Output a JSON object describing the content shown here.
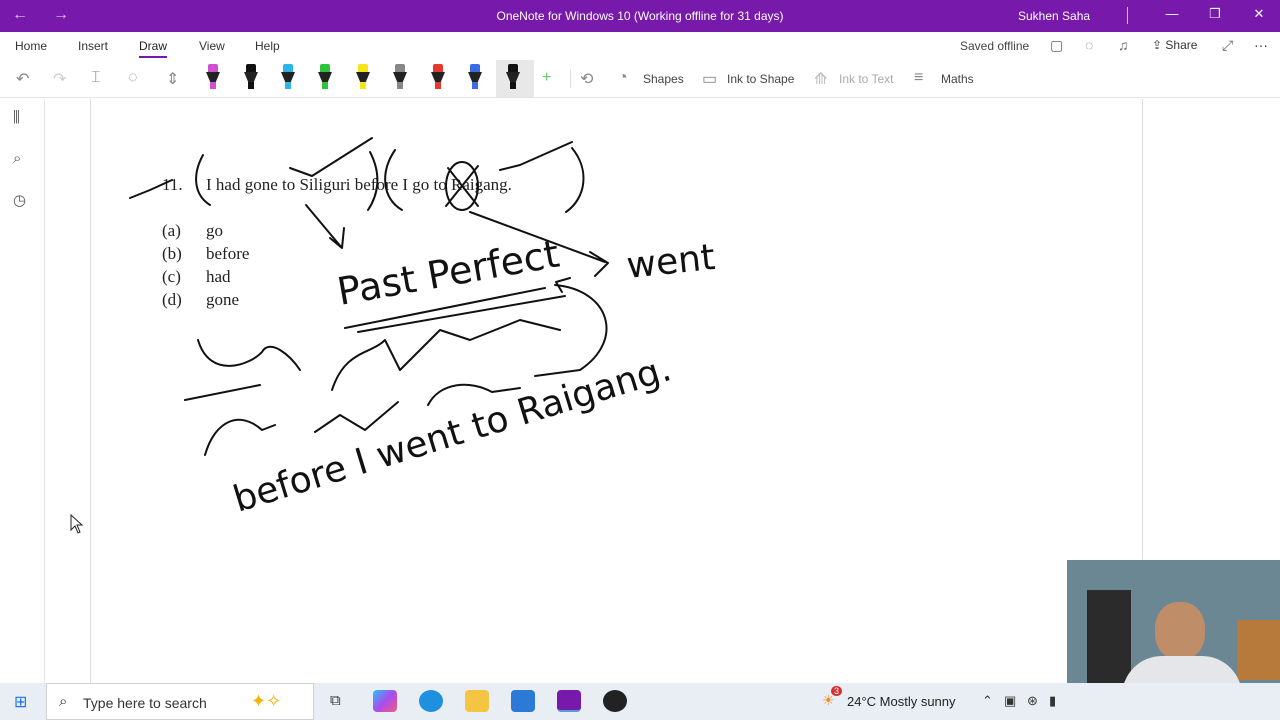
{
  "window": {
    "title": "OneNote for Windows 10 (Working offline for 31 days)",
    "user": "Sukhen Saha",
    "back_icon": "arrow-left-icon",
    "forward_icon": "arrow-right-icon"
  },
  "ribbon": {
    "tabs": [
      "Home",
      "Insert",
      "Draw",
      "View",
      "Help"
    ],
    "active_tab": "Draw",
    "status": "Saved offline",
    "share_label": "Share",
    "more_label": "···"
  },
  "toolbar": {
    "shapes_label": "Shapes",
    "ink_to_shape_label": "Ink to Shape",
    "ink_to_text_label": "Ink to Text",
    "maths_label": "Maths",
    "pen_colors": [
      "#d14fd1",
      "#111111",
      "#2bb6e8",
      "#2ec43a",
      "#f5e416",
      "#888888",
      "#e23b2e",
      "#3a6de2",
      "#111111"
    ]
  },
  "note": {
    "question_number": "11.",
    "sentence": "I had gone to Siliguri before I go to Raigang.",
    "options": [
      {
        "label": "(a)",
        "text": "go"
      },
      {
        "label": "(b)",
        "text": "before"
      },
      {
        "label": "(c)",
        "text": "had"
      },
      {
        "label": "(d)",
        "text": "gone"
      }
    ],
    "ink_text": {
      "tense": "Past Perfect",
      "answer_word": "went",
      "corrected": "before I went to Raigang."
    }
  },
  "taskbar": {
    "search_placeholder": "Type here to search",
    "weather": "24°C  Mostly sunny",
    "weather_badge": "3"
  }
}
